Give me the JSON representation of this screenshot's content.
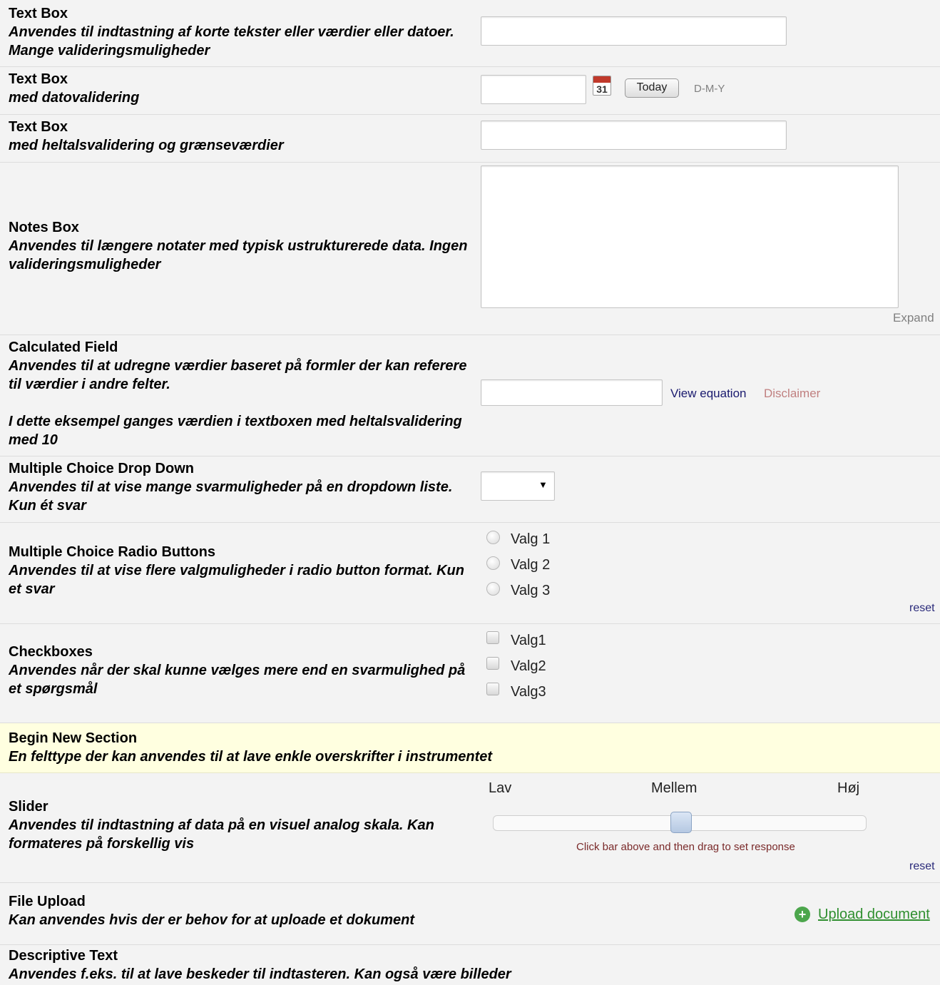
{
  "textbox": {
    "title": "Text Box",
    "description": "Anvendes til indtastning af korte tekster eller værdier eller datoer. Mange valideringsmuligheder",
    "value": ""
  },
  "datebox": {
    "title": "Text Box",
    "description": "med datovalidering",
    "value": "",
    "calendar_day": "31",
    "today_label": "Today",
    "format_label": "D-M-Y"
  },
  "intbox": {
    "title": "Text Box",
    "description": "med heltalsvalidering og grænseværdier",
    "value": ""
  },
  "notes": {
    "title": "Notes Box",
    "description": "Anvendes til længere notater med typisk ustrukturerede data. Ingen valideringsmuligheder",
    "value": "",
    "expand_label": "Expand"
  },
  "calc": {
    "title": "Calculated Field",
    "description": "Anvendes til at udregne værdier baseret på formler der kan referere til værdier i andre felter.",
    "description2": "I dette eksempel ganges værdien i textboxen med heltalsvalidering med 10",
    "value": "",
    "view_equation": "View equation",
    "disclaimer": "Disclaimer"
  },
  "dropdown": {
    "title": "Multiple Choice Drop Down",
    "description": "Anvendes til at vise mange svarmuligheder på en dropdown liste. Kun ét svar",
    "selected": "",
    "arrow": "▼"
  },
  "radios": {
    "title": "Multiple Choice Radio Buttons",
    "description": "Anvendes til at vise flere valgmuligheder i radio button format. Kun et svar",
    "options": [
      "Valg 1",
      "Valg 2",
      "Valg 3"
    ],
    "reset_label": "reset"
  },
  "checkboxes": {
    "title": "Checkboxes",
    "description": "Anvendes når der skal kunne vælges mere end en svarmulighed på et spørgsmål",
    "options": [
      "Valg1",
      "Valg2",
      "Valg3"
    ]
  },
  "section": {
    "title": "Begin New Section",
    "description": "En felttype der kan anvendes til at lave enkle overskrifter i instrumentet"
  },
  "slider": {
    "title": "Slider",
    "description": "Anvendes til indtastning af data på en visuel analog skala. Kan formateres på forskellig vis",
    "low": "Lav",
    "mid": "Mellem",
    "high": "Høj",
    "value": 0.5,
    "hint": "Click bar above and then drag to set response",
    "reset_label": "reset"
  },
  "upload": {
    "title": "File Upload",
    "description": "Kan anvendes hvis der er behov for at uploade et dokument",
    "link": "Upload document"
  },
  "descriptive": {
    "title": "Descriptive Text",
    "description": "Anvendes f.eks. til at lave beskeder til indtasteren. Kan også være billeder"
  }
}
